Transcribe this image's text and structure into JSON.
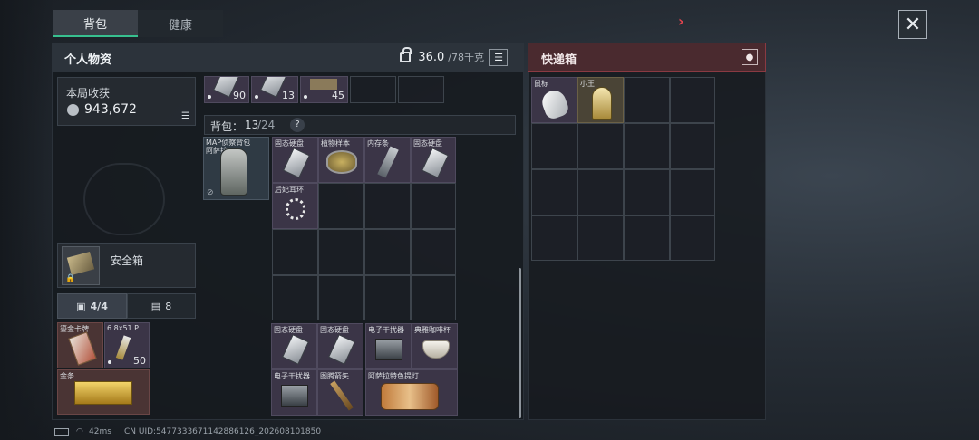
{
  "tabs": [
    {
      "label": "背包"
    },
    {
      "label": "健康"
    }
  ],
  "left_panel": {
    "title": "个人物资",
    "weight_current": "36.0",
    "weight_max": "/78千克"
  },
  "right_panel": {
    "title": "快递箱"
  },
  "earnings": {
    "label": "本局收获",
    "value": "943,672"
  },
  "top_row": [
    {
      "count": "90"
    },
    {
      "count": "13"
    },
    {
      "count": "45"
    },
    {
      "count": ""
    },
    {
      "count": ""
    }
  ],
  "backpack": {
    "label": "背包：",
    "used": "13",
    "capacity": "/24",
    "help": "?",
    "equipped_name": "MAP侦察背包\n阿萨拉"
  },
  "backpack_grid": [
    {
      "name": "固态硬盘"
    },
    {
      "name": "植物样本"
    },
    {
      "name": "内存条"
    },
    {
      "name": "固态硬盘"
    },
    {
      "name": "后妃耳环"
    }
  ],
  "bottom_grid": [
    {
      "name": "固态硬盘"
    },
    {
      "name": "固态硬盘"
    },
    {
      "name": "电子干扰器"
    },
    {
      "name": "典雅咖啡杯"
    },
    {
      "name": "电子干扰器"
    },
    {
      "name": "图腾箭矢"
    },
    {
      "name": "阿萨拉特色提灯"
    }
  ],
  "safe_box": {
    "label": "安全箱"
  },
  "safe_tabs": [
    {
      "label": "4/4"
    },
    {
      "label": "8"
    }
  ],
  "safe_items": [
    {
      "name": "鎏金卡牌"
    },
    {
      "name": "6.8x51 P",
      "count": "50"
    },
    {
      "name": "金条"
    }
  ],
  "delivery_items": [
    {
      "name": "鼠标"
    },
    {
      "name": "小王"
    }
  ],
  "status_bar": {
    "ping": "42ms",
    "uid": "CN UID:5477333671142886126_202608101850"
  }
}
